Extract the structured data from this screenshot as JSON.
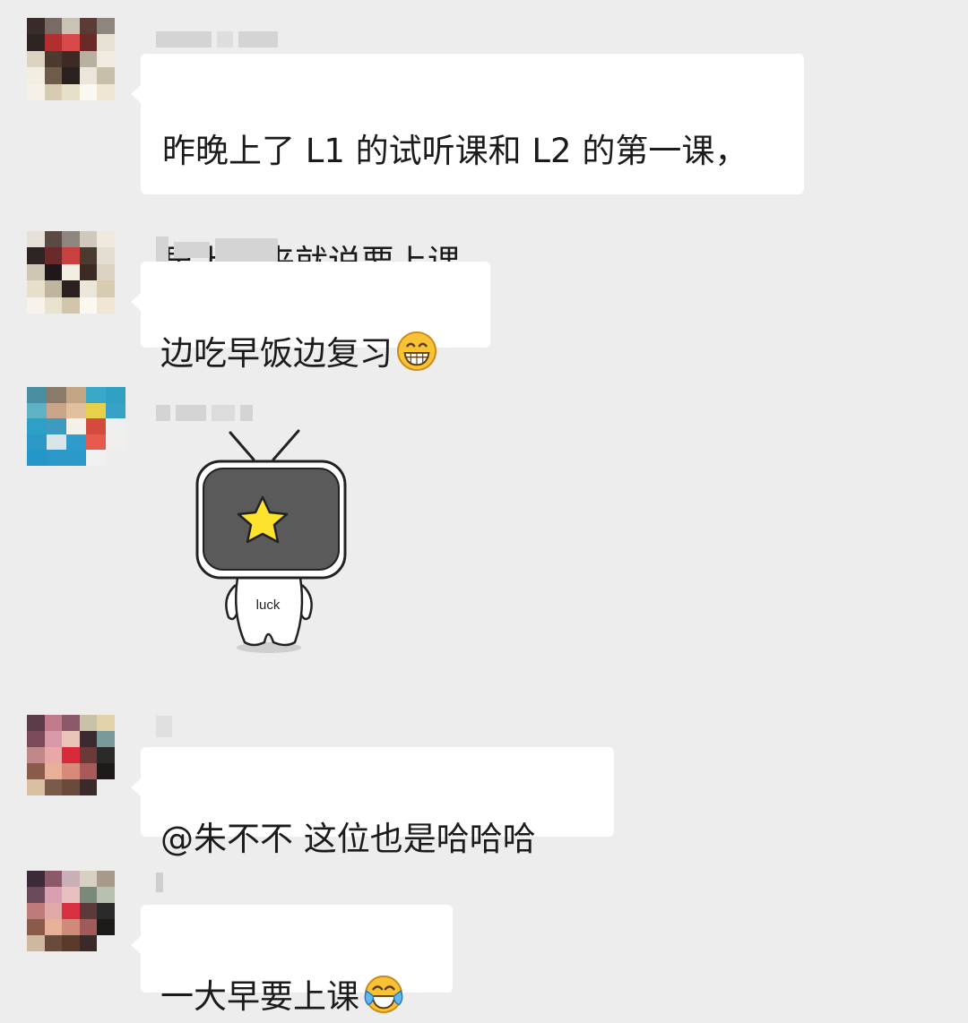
{
  "messages": [
    {
      "id": "msg1",
      "text_line1": "昨晚上了 L1 的试听课和 L2 的第一课，",
      "text_line2": "早上起来就说要上课。",
      "avatar_colors": [
        "#3a2b2b",
        "#7a6a66",
        "#c9c2b5",
        "#5a3b36",
        "#8d857e",
        "#2f2424",
        "#b03030",
        "#d84a4a",
        "#6b2a2a",
        "#e6e0d5",
        "#dcd3c2",
        "#4a3a30",
        "#3d2a25",
        "#b8b0a0",
        "#f0ebe0",
        "#f2eee2",
        "#6f5b4a",
        "#2a2020",
        "#ece6da",
        "#c8bfa8",
        "#f5f1e8",
        "#d7cbb2",
        "#e8dfca",
        "#fbf8f1",
        "#efe6d3"
      ]
    },
    {
      "id": "msg2",
      "text": "边吃早饭边复习",
      "emoji": "grinning-face-icon",
      "avatar_colors": [
        "#e5e0d8",
        "#5a4a44",
        "#8d857e",
        "#d0c8bd",
        "#efe9de",
        "#2f2424",
        "#6b2a2a",
        "#c94040",
        "#4a3a30",
        "#e3ddd2",
        "#cfc6b4",
        "#1f1818",
        "#f2eee2",
        "#3d2a25",
        "#dcd3c2",
        "#e8dfca",
        "#bfb59f",
        "#2a2020",
        "#ece6da",
        "#d7cbb2",
        "#f7f3ea",
        "#e9e2cf",
        "#d1c6ac",
        "#fbf8f1",
        "#efe6d3"
      ]
    },
    {
      "id": "msg3",
      "sticker_label": "luck",
      "avatar_colors": [
        "#4a8fa1",
        "#8a7a6a",
        "#c2a585",
        "#3aa8c8",
        "#2f9fc2",
        "#5fb1c4",
        "#c9a58a",
        "#e2c09f",
        "#e9d04a",
        "#37a2c5",
        "#2ea0c8",
        "#3c9cc0",
        "#f4f0ea",
        "#d24b3c",
        "#eef0ee",
        "#2b98c6",
        "#d8e6ea",
        "#2e9bcb",
        "#e65a4c",
        "#f1eeeb",
        "#2496c8",
        "#2a98c8",
        "#2b9ac8",
        "#f0f0f0",
        "#ededed"
      ]
    },
    {
      "id": "msg4",
      "text": "@朱不不  这位也是哈哈哈",
      "avatar_colors": [
        "#5b3a4a",
        "#c07a8a",
        "#8a5a6a",
        "#c9c2a8",
        "#e2d4a8",
        "#7a4a5a",
        "#d89aa8",
        "#e8c4b8",
        "#3b2a30",
        "#7a9a9a",
        "#c08888",
        "#e8a8a8",
        "#d82a3a",
        "#6a3a3a",
        "#2a2a2a",
        "#8a5a4a",
        "#e8b098",
        "#d88a7a",
        "#a85a5a",
        "#1f1a1a",
        "#d8c0a0",
        "#7a5a4a",
        "#6a4a3a",
        "#3a2a2a",
        "#ededed"
      ]
    },
    {
      "id": "msg5",
      "text": "一大早要上课",
      "emoji": "face-with-tears-of-joy-icon",
      "avatar_colors": [
        "#3a2a3a",
        "#8a5a6a",
        "#c9b0b8",
        "#d8d0c0",
        "#a89a8a",
        "#6a4a5a",
        "#d8a0b0",
        "#e8c0c0",
        "#7a8a7a",
        "#b8c0b0",
        "#c07a7a",
        "#e0a8a8",
        "#d83040",
        "#5a3a3a",
        "#2a2a2a",
        "#8a5a4a",
        "#e8b098",
        "#d08a7a",
        "#a05a5a",
        "#1f1a1a",
        "#d0b8a0",
        "#6a4a3a",
        "#5a3a2a",
        "#3a2a2a",
        "#ededed"
      ]
    }
  ]
}
